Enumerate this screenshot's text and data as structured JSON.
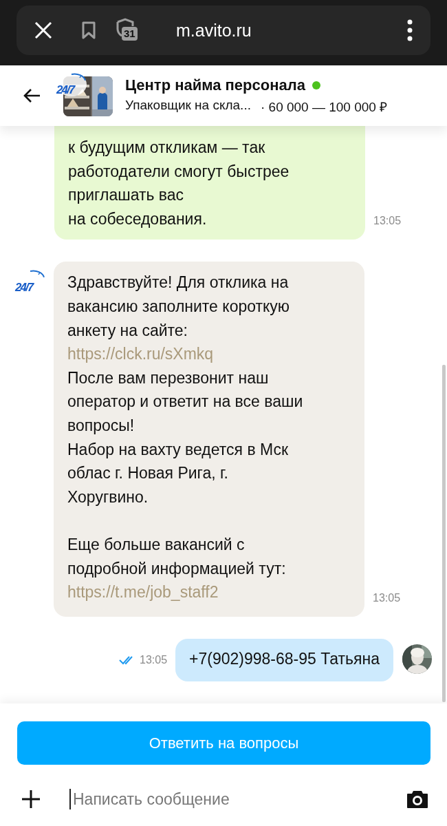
{
  "browser": {
    "url": "m.avito.ru",
    "tabs_count": "31"
  },
  "header": {
    "logo": "24/7",
    "title": "Центр найма персонала",
    "online": true,
    "subtitle": "Упаковщик на скла...",
    "price": "· 60 000 — 100 000 ₽"
  },
  "messages": [
    {
      "kind": "notice",
      "time": "13:05",
      "paragraphs": [
        [
          {
            "text": "к будущим откликам — так",
            "link": false
          },
          {
            "text": "работодатели смогут быстрее",
            "link": false
          },
          {
            "text": "приглашать вас",
            "link": false
          },
          {
            "text": "на собеседования.",
            "link": false
          }
        ]
      ]
    },
    {
      "kind": "incoming",
      "avatar_logo": "24/7",
      "time": "13:05",
      "paragraphs": [
        [
          {
            "text": "Здравствуйте! Для отклика на",
            "link": false
          },
          {
            "text": "вакансию заполните короткую",
            "link": false
          },
          {
            "text": "анкету на сайте:",
            "link": false
          },
          {
            "text": "https://clck.ru/sXmkq",
            "link": true
          },
          {
            "text": "После вам перезвонит наш",
            "link": false
          },
          {
            "text": "оператор и ответит на все ваши",
            "link": false
          },
          {
            "text": "вопросы!",
            "link": false
          },
          {
            "text": "Набор на вахту ведется в Мск",
            "link": false
          },
          {
            "text": "облас г. Новая Рига, г.",
            "link": false
          },
          {
            "text": "Хоругвино.",
            "link": false
          }
        ],
        [
          {
            "text": "Еще больше вакансий с",
            "link": false
          },
          {
            "text": "подробной информацией тут:",
            "link": false
          },
          {
            "text": "https://t.me/job_staff2",
            "link": true
          }
        ]
      ]
    },
    {
      "kind": "outgoing",
      "time": "13:05",
      "read": true,
      "paragraphs": [
        [
          {
            "text": "+7(902)998-68-95 Татьяна",
            "link": false
          }
        ]
      ]
    }
  ],
  "reply_button": "Ответить на вопросы",
  "composer": {
    "placeholder": "Написать сообщение"
  }
}
